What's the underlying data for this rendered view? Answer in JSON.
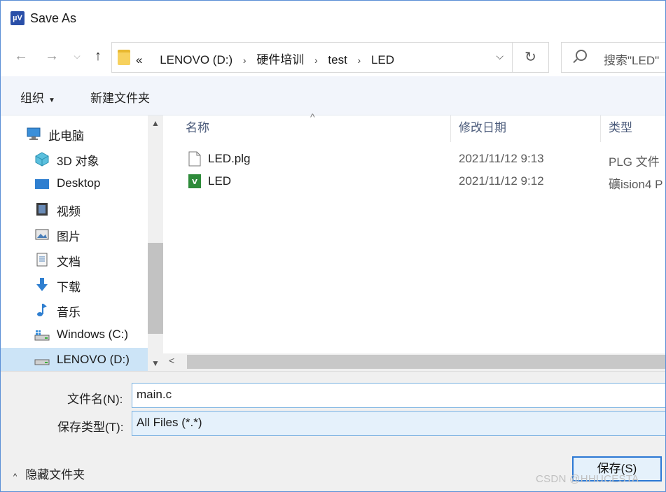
{
  "window": {
    "title": "Save As",
    "app_icon_text": "µV"
  },
  "nav": {
    "breadcrumb_prefix": "«",
    "breadcrumbs": [
      "LENOVO (D:)",
      "硬件培训",
      "test",
      "LED"
    ],
    "search_placeholder": "搜索\"LED\""
  },
  "toolbar": {
    "organize_label": "组织",
    "new_folder_label": "新建文件夹"
  },
  "sidebar": {
    "items": [
      {
        "label": "此电脑",
        "icon": "computer-icon"
      },
      {
        "label": "3D 对象",
        "icon": "3d-objects-icon"
      },
      {
        "label": "Desktop",
        "icon": "desktop-icon"
      },
      {
        "label": "视频",
        "icon": "video-icon"
      },
      {
        "label": "图片",
        "icon": "pictures-icon"
      },
      {
        "label": "文档",
        "icon": "documents-icon"
      },
      {
        "label": "下载",
        "icon": "downloads-icon"
      },
      {
        "label": "音乐",
        "icon": "music-icon"
      },
      {
        "label": "Windows (C:)",
        "icon": "drive-icon"
      },
      {
        "label": "LENOVO (D:)",
        "icon": "drive-icon",
        "selected": true
      }
    ]
  },
  "columns": {
    "name": "名称",
    "date": "修改日期",
    "type": "类型"
  },
  "files": [
    {
      "name": "LED.plg",
      "date": "2021/11/12 9:13",
      "type": "PLG 文件",
      "icon": "file-icon"
    },
    {
      "name": "LED",
      "date": "2021/11/12 9:12",
      "type": "礦ision4 P",
      "icon": "uvision-project-icon"
    }
  ],
  "form": {
    "filename_label": "文件名(N):",
    "filename_value": "main.c",
    "filetype_label": "保存类型(T):",
    "filetype_value": "All Files (*.*)"
  },
  "footer": {
    "hide_folders_label": "隐藏文件夹",
    "save_label": "保存(S)"
  },
  "watermark": "CSDN @HHUCESTA",
  "colors": {
    "accent": "#2b78d4",
    "selected_bg": "#cce4f7",
    "toolbar_bg": "#f2f5fb"
  }
}
